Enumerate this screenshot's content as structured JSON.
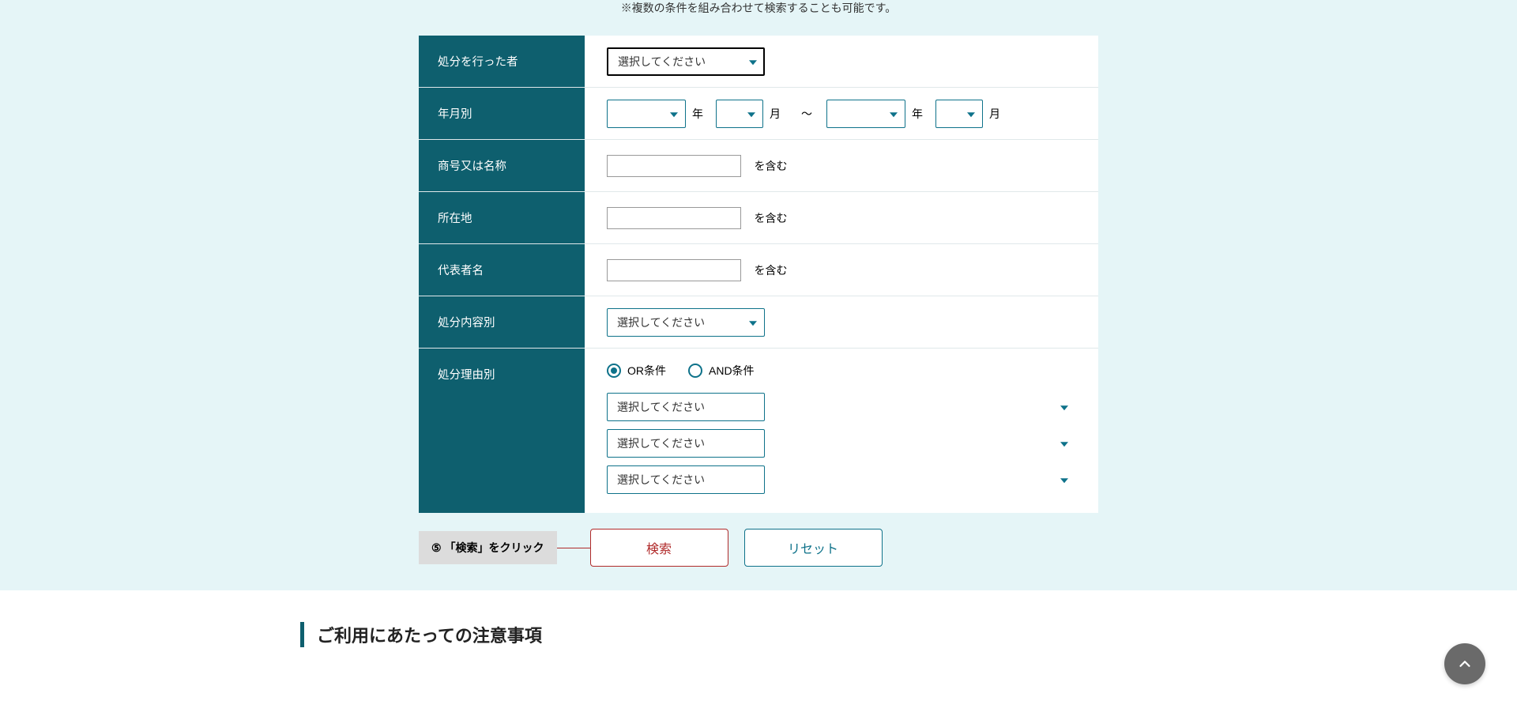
{
  "top_note": "※複数の条件を組み合わせて検索することも可能です。",
  "form": {
    "processor": {
      "label": "処分を行った者",
      "placeholder": "選択してください"
    },
    "by_month": {
      "label": "年月別",
      "year_label": "年",
      "month_label": "月",
      "range_sep": "～"
    },
    "company_name": {
      "label": "商号又は名称",
      "suffix": "を含む"
    },
    "address": {
      "label": "所在地",
      "suffix": "を含む"
    },
    "representative": {
      "label": "代表者名",
      "suffix": "を含む"
    },
    "disposition_type": {
      "label": "処分内容別",
      "placeholder": "選択してください"
    },
    "reason": {
      "label": "処分理由別",
      "radio_or": "OR条件",
      "radio_and": "AND条件",
      "placeholder": "選択してください"
    }
  },
  "step": {
    "number": "⑤",
    "text": "「検索」をクリック"
  },
  "buttons": {
    "search": "検索",
    "reset": "リセット"
  },
  "notice_heading": "ご利用にあたっての注意事項"
}
